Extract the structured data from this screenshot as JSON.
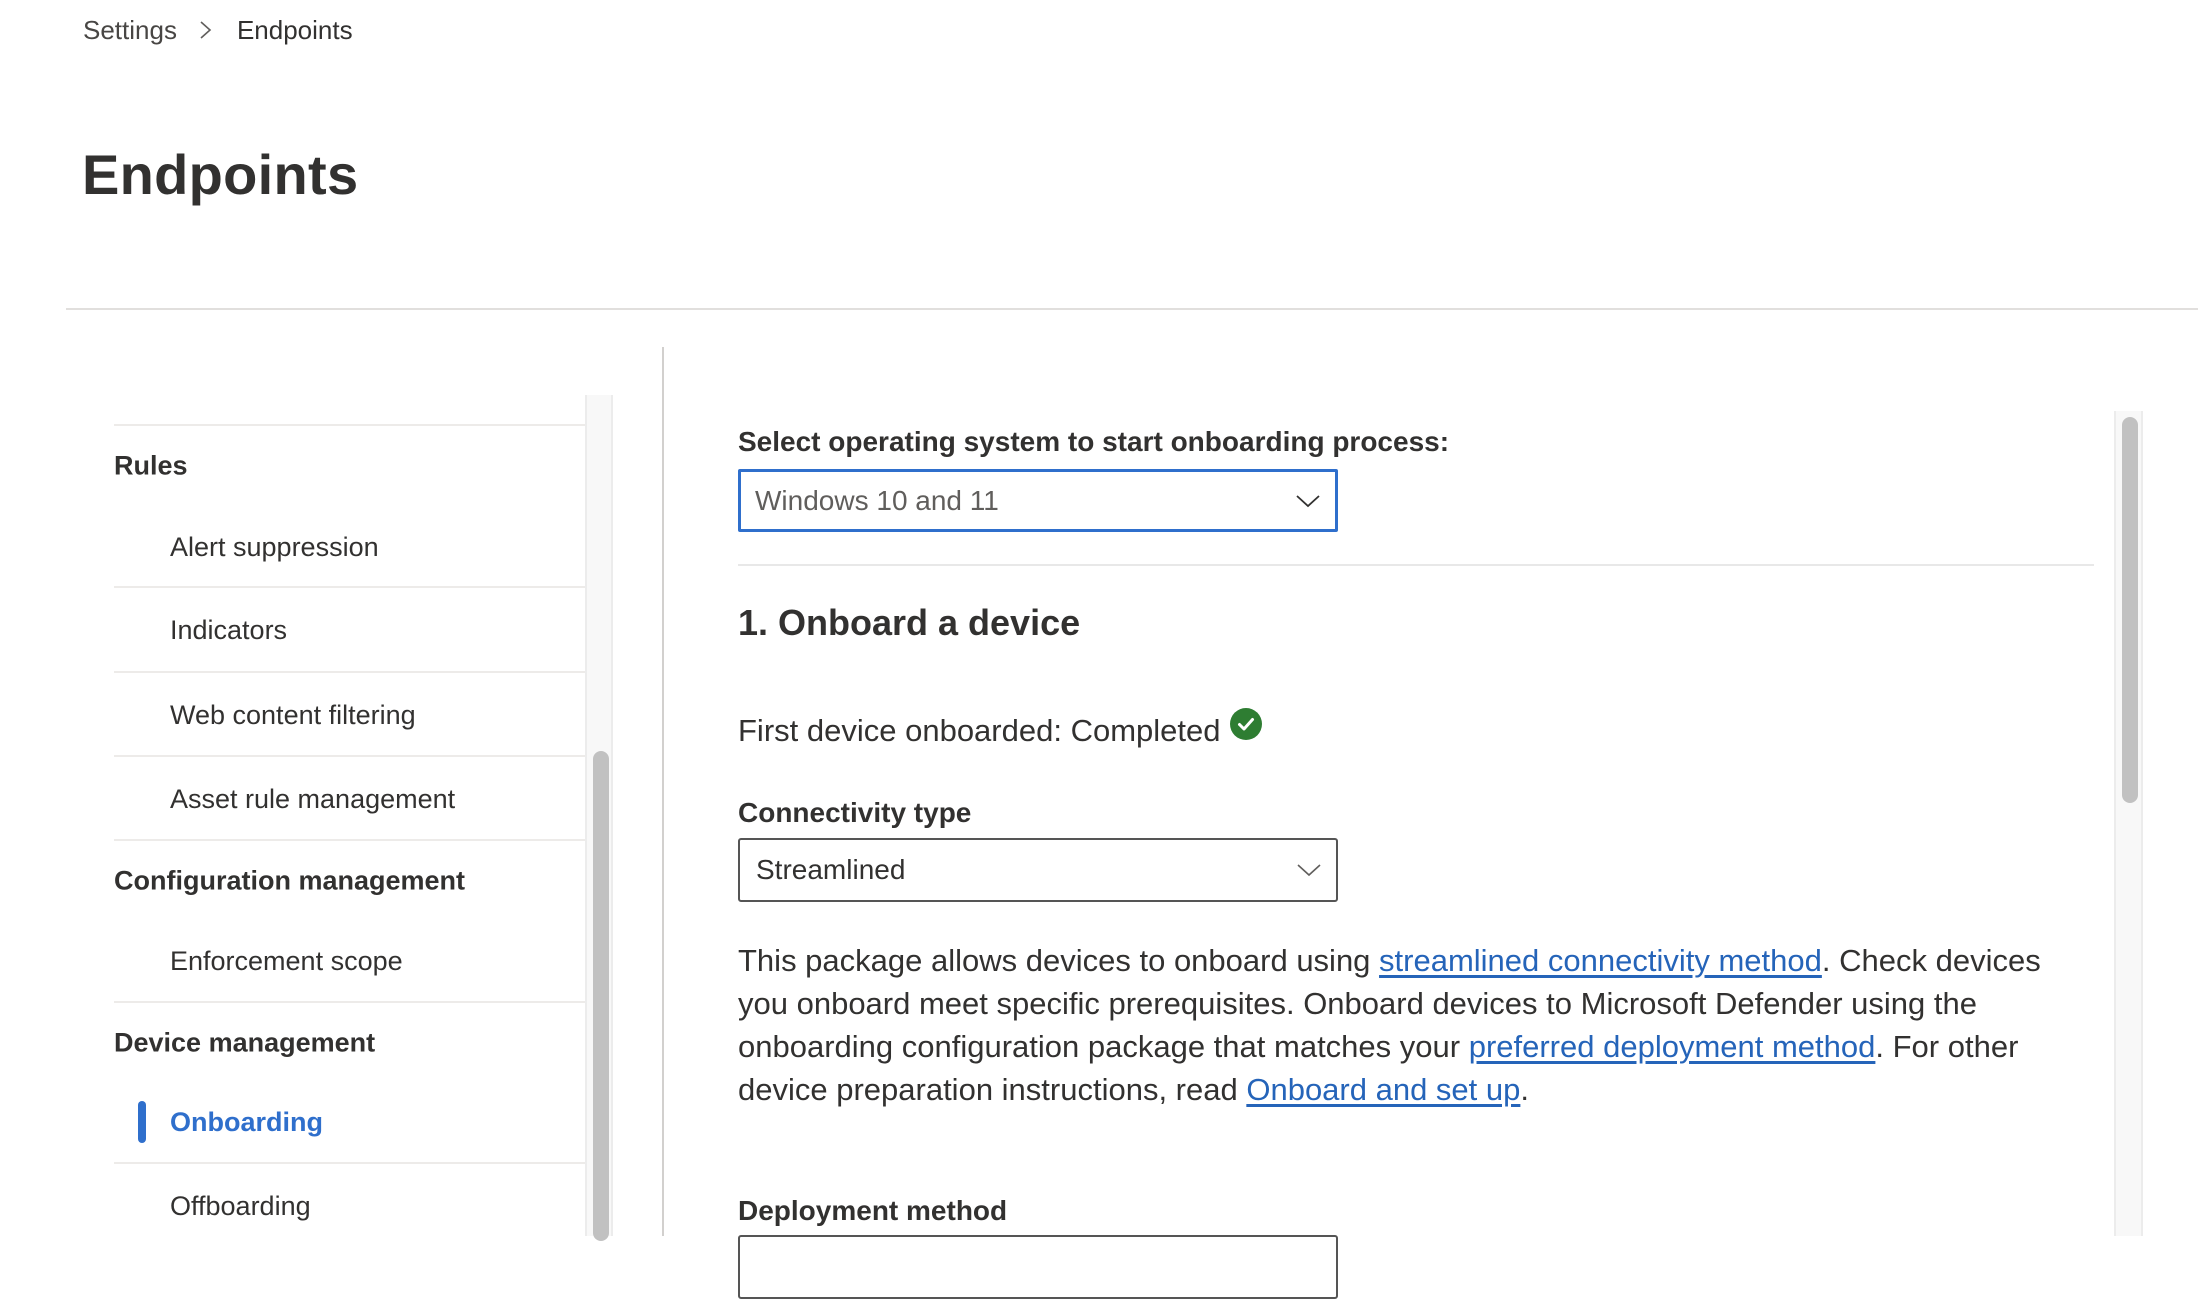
{
  "breadcrumb": {
    "items": [
      "Settings",
      "Endpoints"
    ],
    "separator_icon": "chevron-right-icon"
  },
  "page": {
    "title": "Endpoints"
  },
  "sidebar": {
    "groups": [
      {
        "label": "Rules",
        "items": [
          {
            "label": "Alert suppression",
            "active": false
          },
          {
            "label": "Indicators",
            "active": false
          },
          {
            "label": "Web content filtering",
            "active": false
          },
          {
            "label": "Asset rule management",
            "active": false
          }
        ]
      },
      {
        "label": "Configuration management",
        "items": [
          {
            "label": "Enforcement scope",
            "active": false
          }
        ]
      },
      {
        "label": "Device management",
        "items": [
          {
            "label": "Onboarding",
            "active": true
          },
          {
            "label": "Offboarding",
            "active": false
          }
        ]
      }
    ]
  },
  "main": {
    "os_select": {
      "label": "Select operating system to start onboarding process:",
      "value": "Windows 10 and 11"
    },
    "section": {
      "heading": "1. Onboard a device",
      "status_text": "First device onboarded: Completed",
      "status_icon": "check-circle-icon",
      "status_color": "#2e7d32"
    },
    "connectivity": {
      "label": "Connectivity type",
      "value": "Streamlined"
    },
    "description": {
      "t1": "This package allows devices to onboard using ",
      "link1": "streamlined connectivity method",
      "t2": ". Check devices you onboard meet specific prerequisites. Onboard devices to Microsoft Defender using the onboarding configuration package that matches your ",
      "link2": "preferred deployment method",
      "t3": ". For other device preparation instructions, read ",
      "link3": "Onboard and set up",
      "t4": "."
    },
    "deployment": {
      "label": "Deployment method"
    }
  },
  "colors": {
    "accent": "#2f6fcc",
    "link": "#2564b9",
    "success": "#2e7d32",
    "text": "#323130"
  }
}
